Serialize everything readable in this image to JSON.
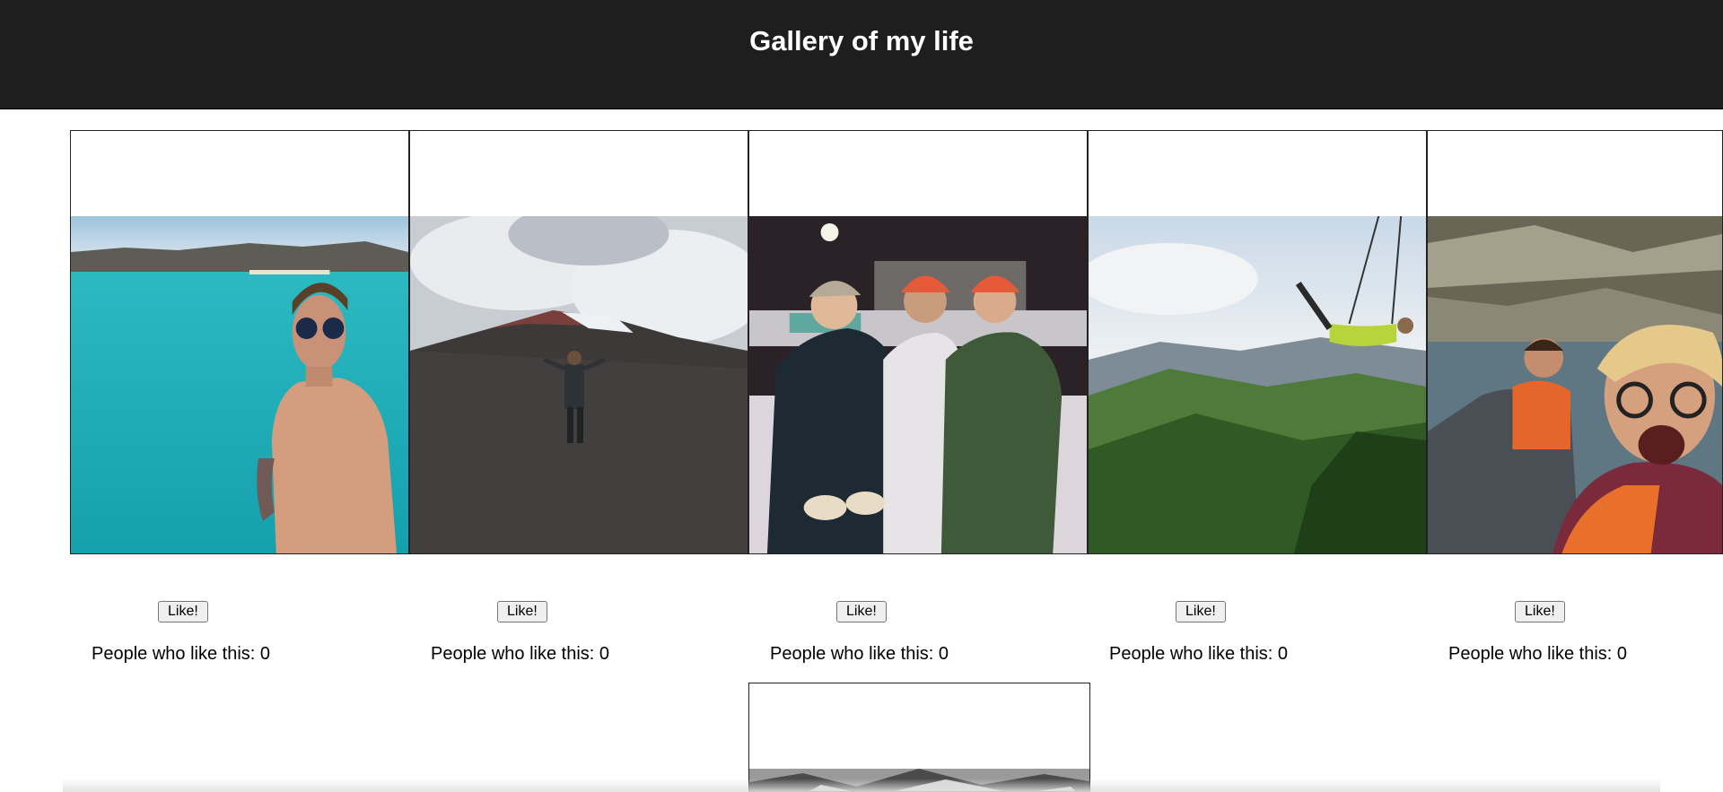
{
  "header": {
    "title": "Gallery of my life"
  },
  "gallery": {
    "items": [
      {
        "photo_icon": "photo-beach-selfie",
        "like_label": "Like!",
        "likes_text": "People who like this: 0",
        "likes": 0
      },
      {
        "photo_icon": "photo-volcano-hike",
        "like_label": "Like!",
        "likes_text": "People who like this: 0",
        "likes": 0
      },
      {
        "photo_icon": "photo-friends-ice-rink",
        "like_label": "Like!",
        "likes_text": "People who like this: 0",
        "likes": 0
      },
      {
        "photo_icon": "photo-mountain-swing",
        "like_label": "Like!",
        "likes_text": "People who like this: 0",
        "likes": 0
      },
      {
        "photo_icon": "photo-lake-kayak-selfie",
        "like_label": "Like!",
        "likes_text": "People who like this: 0",
        "likes": 0
      },
      {
        "photo_icon": "photo-black-and-white",
        "partially_visible": true
      }
    ]
  },
  "colors": {
    "header_bg": "#1e1e1e",
    "header_text": "#ffffff",
    "page_bg": "#ffffff"
  }
}
